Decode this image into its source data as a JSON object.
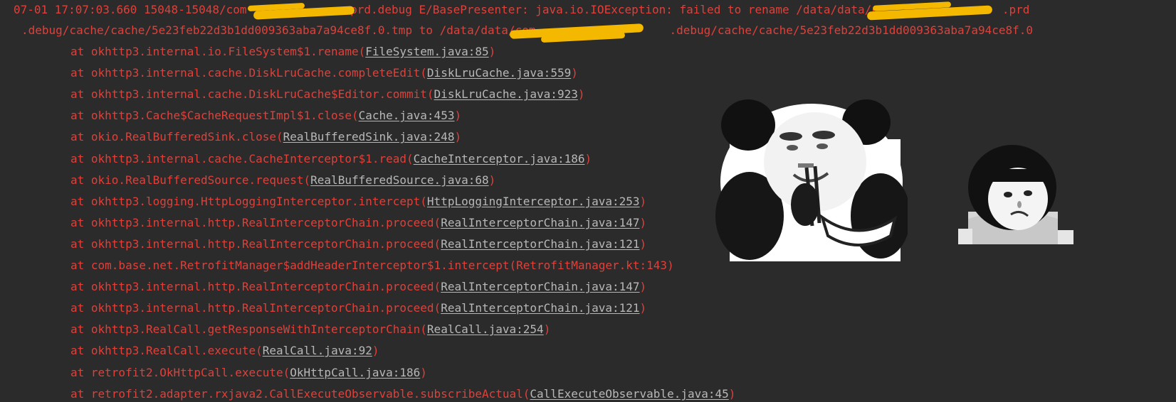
{
  "log": {
    "header_line1_before_redaction": "07-01 17:07:03.660 15048-15048/com",
    "header_line1_after_redaction": ".prd.debug E/BasePresenter: java.io.IOException: failed to rename /data/data/c",
    "header_line1_end": ".prd",
    "header_line2_before_redaction": ".debug/cache/cache/5e23feb22d3b1dd009363aba7a94ce8f.0.tmp to /data/data/com",
    "header_line2_after_redaction": ".debug/cache/cache/5e23feb22d3b1dd009363aba7a94ce8f.0",
    "frames": [
      {
        "method": "at okhttp3.internal.io.FileSystem$1.rename",
        "location": "FileSystem.java:85",
        "linked": true
      },
      {
        "method": "at okhttp3.internal.cache.DiskLruCache.completeEdit",
        "location": "DiskLruCache.java:559",
        "linked": true
      },
      {
        "method": "at okhttp3.internal.cache.DiskLruCache$Editor.commit",
        "location": "DiskLruCache.java:923",
        "linked": true
      },
      {
        "method": "at okhttp3.Cache$CacheRequestImpl$1.close",
        "location": "Cache.java:453",
        "linked": true
      },
      {
        "method": "at okio.RealBufferedSink.close",
        "location": "RealBufferedSink.java:248",
        "linked": true
      },
      {
        "method": "at okhttp3.internal.cache.CacheInterceptor$1.read",
        "location": "CacheInterceptor.java:186",
        "linked": true
      },
      {
        "method": "at okio.RealBufferedSource.request",
        "location": "RealBufferedSource.java:68",
        "linked": true
      },
      {
        "method": "at okhttp3.logging.HttpLoggingInterceptor.intercept",
        "location": "HttpLoggingInterceptor.java:253",
        "linked": true
      },
      {
        "method": "at okhttp3.internal.http.RealInterceptorChain.proceed",
        "location": "RealInterceptorChain.java:147",
        "linked": true
      },
      {
        "method": "at okhttp3.internal.http.RealInterceptorChain.proceed",
        "location": "RealInterceptorChain.java:121",
        "linked": true
      },
      {
        "method": "at com.base.net.RetrofitManager$addHeaderInterceptor$1.intercept",
        "location": "RetrofitManager.kt:143",
        "linked": false
      },
      {
        "method": "at okhttp3.internal.http.RealInterceptorChain.proceed",
        "location": "RealInterceptorChain.java:147",
        "linked": true
      },
      {
        "method": "at okhttp3.internal.http.RealInterceptorChain.proceed",
        "location": "RealInterceptorChain.java:121",
        "linked": true
      },
      {
        "method": "at okhttp3.RealCall.getResponseWithInterceptorChain",
        "location": "RealCall.java:254",
        "linked": true
      },
      {
        "method": "at okhttp3.RealCall.execute",
        "location": "RealCall.java:92",
        "linked": true
      },
      {
        "method": "at retrofit2.OkHttpCall.execute",
        "location": "OkHttpCall.java:186",
        "linked": true
      },
      {
        "method": "at retrofit2.adapter.rxjava2.CallExecuteObservable.subscribeActual",
        "location": "CallExecuteObservable.java:45",
        "linked": true
      }
    ]
  },
  "colors": {
    "background": "#2b2b2b",
    "error_text": "#e0403a",
    "link_text": "#b8b8b8",
    "redaction": "#f5b800"
  },
  "stickers": [
    "panda-meme-icon",
    "bowl-cut-kid-meme-icon"
  ]
}
